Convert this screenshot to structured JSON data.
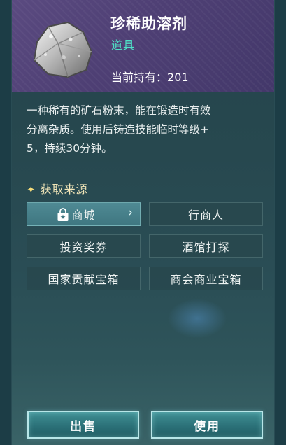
{
  "item": {
    "name": "珍稀助溶剂",
    "type": "道具",
    "owned_label": "当前持有：",
    "owned_count": "201",
    "icon": "ore-powder-icon",
    "description_lines": [
      "一种稀有的矿石粉末，能在锻造时有效",
      "分离杂质。使用后铸造技能临时等级+",
      "5，持续30分钟。"
    ]
  },
  "sources": {
    "title": "获取来源",
    "spark_icon": "✦",
    "items": [
      {
        "label": "商城",
        "icon": "shop-bag-icon",
        "selected": true
      },
      {
        "label": "行商人"
      },
      {
        "label": "投资奖券"
      },
      {
        "label": "酒馆打探"
      },
      {
        "label": "国家贡献宝箱"
      },
      {
        "label": "商会商业宝箱"
      }
    ]
  },
  "actions": {
    "sell": "出售",
    "use": "使用"
  },
  "colors": {
    "accent": "#4fe1c6",
    "header": "#4e3f74",
    "panel": "#27484f"
  }
}
